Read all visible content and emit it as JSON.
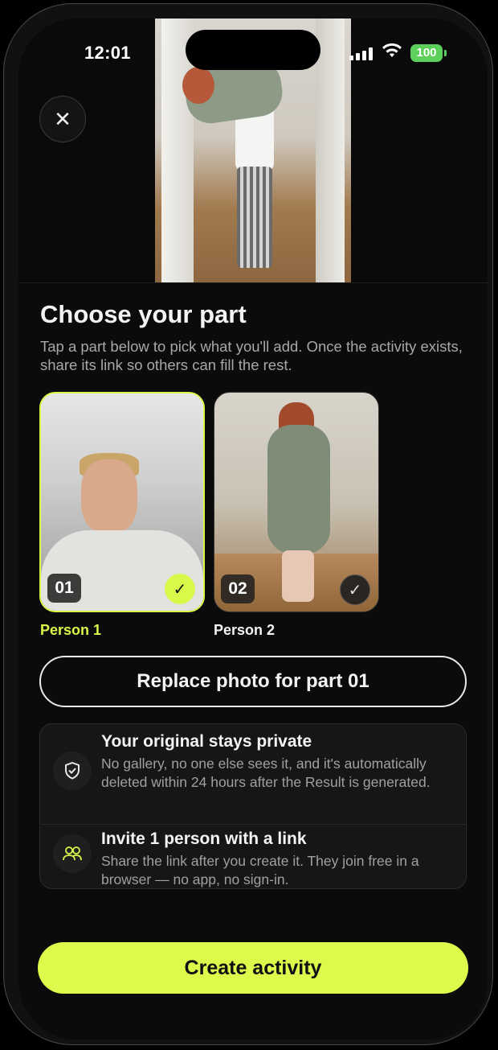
{
  "status": {
    "time": "12:01",
    "battery": "100"
  },
  "icons": {
    "close": "close-icon",
    "shield": "shield-icon",
    "people": "people-icon",
    "check": "check-icon"
  },
  "header": {
    "title": "Choose your part",
    "subtitle": "Tap a part below to pick what you'll add. Once the activity exists, share its link so others can fill the rest."
  },
  "parts": [
    {
      "number": "01",
      "label": "Person 1",
      "selected": true
    },
    {
      "number": "02",
      "label": "Person 2",
      "selected": false
    }
  ],
  "replace_button": "Replace photo for part 01",
  "info": [
    {
      "title": "Your original stays private",
      "text": "No gallery, no one else sees it, and it's automatically deleted within 24 hours after the Result is generated."
    },
    {
      "title": "Invite 1 person with a link",
      "text": "Share the link after you create it. They join free in a browser — no app, no sign-in."
    }
  ],
  "create_button": "Create activity",
  "colors": {
    "accent": "#dcfa4b",
    "background": "#0b0b0c",
    "card": "#161617"
  }
}
